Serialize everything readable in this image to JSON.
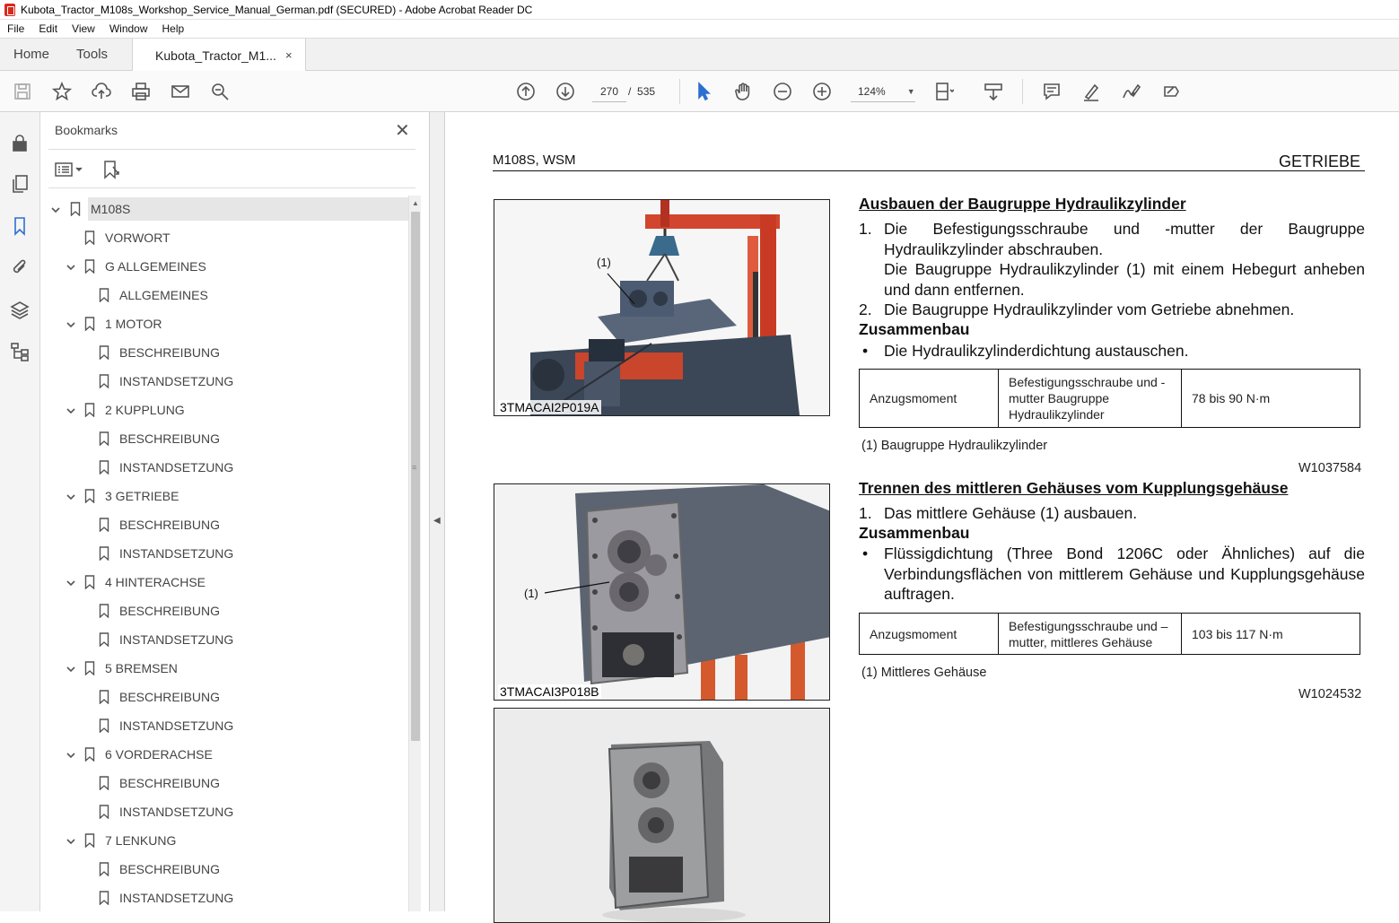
{
  "window": {
    "title": "Kubota_Tractor_M108s_Workshop_Service_Manual_German.pdf (SECURED) - Adobe Acrobat Reader DC"
  },
  "menu": [
    "File",
    "Edit",
    "View",
    "Window",
    "Help"
  ],
  "tabs": {
    "home": "Home",
    "tools": "Tools",
    "document": "Kubota_Tractor_M1...",
    "close": "×"
  },
  "toolbar": {
    "page_current": "270",
    "page_separator": "/",
    "page_total": "535",
    "zoom": "124%"
  },
  "bookmarks": {
    "title": "Bookmarks",
    "close": "✕",
    "items": [
      {
        "label": "M108S",
        "level": 0,
        "expandable": true,
        "selected": true
      },
      {
        "label": "VORWORT",
        "level": 1,
        "expandable": false
      },
      {
        "label": "G ALLGEMEINES",
        "level": 1,
        "expandable": true
      },
      {
        "label": "ALLGEMEINES",
        "level": 2,
        "expandable": false
      },
      {
        "label": "1 MOTOR",
        "level": 1,
        "expandable": true
      },
      {
        "label": "BESCHREIBUNG",
        "level": 2,
        "expandable": false
      },
      {
        "label": "INSTANDSETZUNG",
        "level": 2,
        "expandable": false
      },
      {
        "label": "2 KUPPLUNG",
        "level": 1,
        "expandable": true
      },
      {
        "label": "BESCHREIBUNG",
        "level": 2,
        "expandable": false
      },
      {
        "label": "INSTANDSETZUNG",
        "level": 2,
        "expandable": false
      },
      {
        "label": "3 GETRIEBE",
        "level": 1,
        "expandable": true
      },
      {
        "label": "BESCHREIBUNG",
        "level": 2,
        "expandable": false
      },
      {
        "label": "INSTANDSETZUNG",
        "level": 2,
        "expandable": false
      },
      {
        "label": "4 HINTERACHSE",
        "level": 1,
        "expandable": true
      },
      {
        "label": "BESCHREIBUNG",
        "level": 2,
        "expandable": false
      },
      {
        "label": "INSTANDSETZUNG",
        "level": 2,
        "expandable": false
      },
      {
        "label": "5 BREMSEN",
        "level": 1,
        "expandable": true
      },
      {
        "label": "BESCHREIBUNG",
        "level": 2,
        "expandable": false
      },
      {
        "label": "INSTANDSETZUNG",
        "level": 2,
        "expandable": false
      },
      {
        "label": "6 VORDERACHSE",
        "level": 1,
        "expandable": true
      },
      {
        "label": "BESCHREIBUNG",
        "level": 2,
        "expandable": false
      },
      {
        "label": "INSTANDSETZUNG",
        "level": 2,
        "expandable": false
      },
      {
        "label": "7 LENKUNG",
        "level": 1,
        "expandable": true
      },
      {
        "label": "BESCHREIBUNG",
        "level": 2,
        "expandable": false
      },
      {
        "label": "INSTANDSETZUNG",
        "level": 2,
        "expandable": false
      }
    ]
  },
  "document": {
    "header_left": "M108S, WSM",
    "header_right": "GETRIEBE",
    "photo1": {
      "caption": "3TMACAI2P019A",
      "callout": "(1)"
    },
    "photo2": {
      "caption": "3TMACAI3P018B",
      "callout": "(1)"
    },
    "section1": {
      "title": "Ausbauen der Baugruppe Hydraulikzylinder",
      "step1_num": "1.",
      "step1_a": "Die Befestigungsschraube und -mutter der Baugruppe Hydraulikzylinder abschrauben.",
      "step1_b": "Die Baugruppe Hydraulikzylinder (1) mit einem Hebegurt anheben und dann entfernen.",
      "step2_num": "2.",
      "step2": "Die Baugruppe Hydraulikzylinder vom Getriebe abnehmen.",
      "assembly_heading": "Zusammenbau",
      "bullet_mark": "•",
      "bullet": "Die Hydraulikzylinderdichtung austauschen.",
      "table": {
        "label": "Anzugsmoment",
        "item": "Befestigungsschraube und -mutter Baugruppe Hydraulikzylinder",
        "value": "78 bis 90 N·m"
      },
      "note": "(1)  Baugruppe Hydraulikzylinder",
      "code": "W1037584"
    },
    "section2": {
      "title": "Trennen des mittleren Gehäuses vom Kupplungsgehäuse",
      "step1_num": "1.",
      "step1": "Das mittlere Gehäuse (1) ausbauen.",
      "assembly_heading": "Zusammenbau",
      "bullet_mark": "•",
      "bullet": "Flüssigdichtung (Three Bond 1206C oder Ähnliches) auf die Verbindungsflächen von mittlerem Gehäuse und Kupplungsgehäuse auftragen.",
      "table": {
        "label": "Anzugsmoment",
        "item": "Befestigungsschraube und –mutter, mittleres Gehäuse",
        "value": "103 bis 117 N·m"
      },
      "note": "(1)  Mittleres Gehäuse",
      "code": "W1024532"
    }
  }
}
